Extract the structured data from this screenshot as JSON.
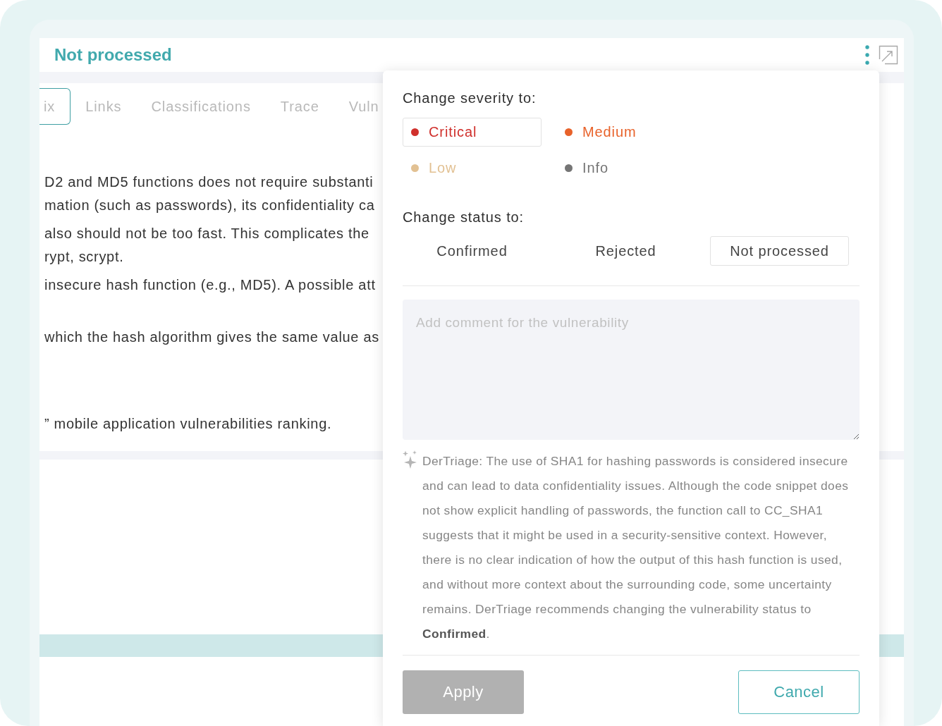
{
  "header": {
    "title": "Not processed"
  },
  "tabs": [
    {
      "label": "ix",
      "selected": true
    },
    {
      "label": "Links",
      "selected": false
    },
    {
      "label": "Classifications",
      "selected": false
    },
    {
      "label": "Trace",
      "selected": false
    },
    {
      "label": "Vuln",
      "selected": false
    }
  ],
  "description": {
    "paragraphs": [
      [
        "D2 and MD5 functions does not require substanti",
        "mation (such as passwords), its confidentiality ca"
      ],
      [
        "also should not be too fast. This complicates the",
        "rypt, scrypt."
      ],
      [
        "insecure hash function (e.g., MD5). A possible att"
      ],
      [
        "which the hash algorithm gives the same value as"
      ],
      [
        "” mobile application vulnerabilities ranking."
      ]
    ]
  },
  "popup": {
    "severity_heading": "Change severity to:",
    "severities": [
      {
        "label": "Critical",
        "color": "#d0302c",
        "selected": true
      },
      {
        "label": "Medium",
        "color": "#e8622a",
        "selected": false
      },
      {
        "label": "Low",
        "color": "#e2c193",
        "selected": false
      },
      {
        "label": "Info",
        "color": "#757575",
        "selected": false
      }
    ],
    "status_heading": "Change status to:",
    "statuses": [
      {
        "label": "Confirmed",
        "selected": false
      },
      {
        "label": "Rejected",
        "selected": false
      },
      {
        "label": "Not processed",
        "selected": true
      }
    ],
    "comment": {
      "placeholder": "Add comment for the vulnerability"
    },
    "ai_note": "DerTriage: The use of SHA1 for hashing passwords is considered insecure and can lead to data confidentiality issues. Although the code snippet does not show explicit handling of passwords, the function call to CC_SHA1 suggests that it might be used in a security-sensitive context. However, there is no clear indication of how the output of this hash function is used, and without more context about the surrounding code, some uncertainty remains. DerTriage recommends changing the vulnerability status to **Confirmed**.",
    "apply": {
      "label": "Apply",
      "disabled": true
    },
    "cancel": {
      "label": "Cancel"
    }
  }
}
